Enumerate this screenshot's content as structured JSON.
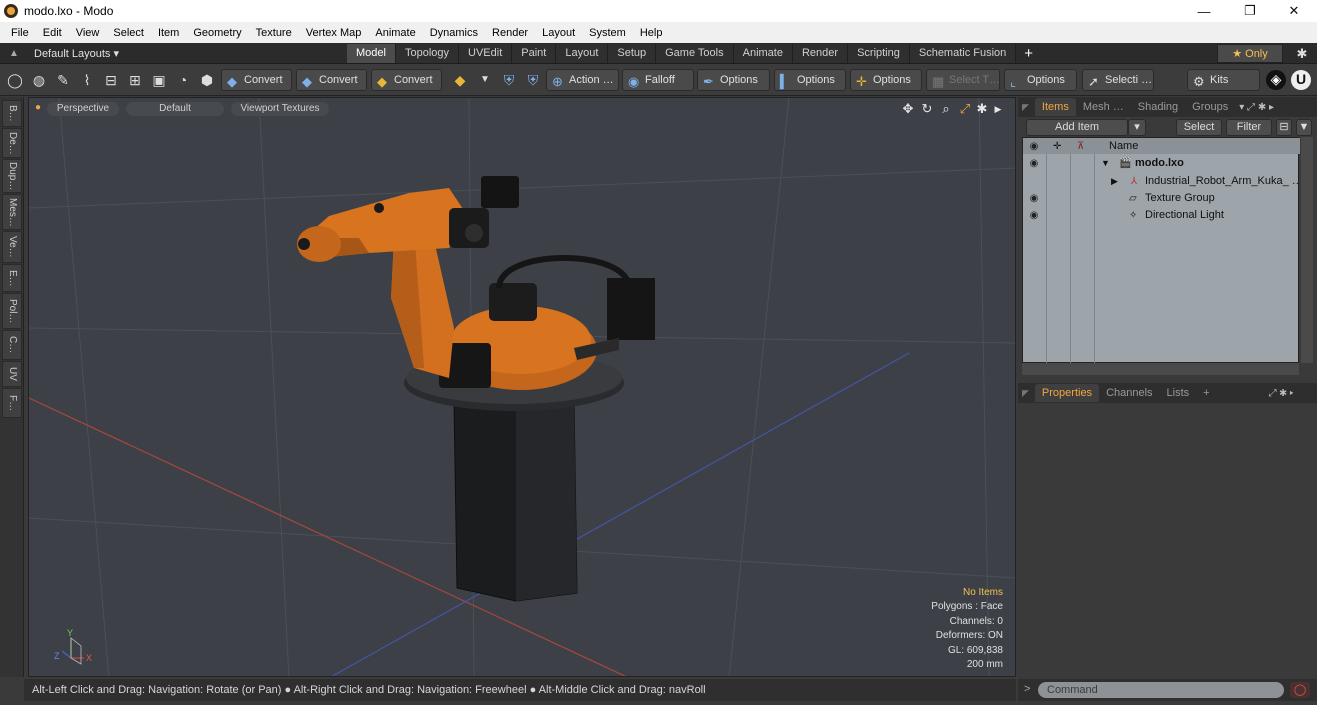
{
  "window": {
    "title": "modo.lxo - Modo",
    "minimize_glyph": "—",
    "restore_glyph": "❐",
    "close_glyph": "✕"
  },
  "menu": [
    "File",
    "Edit",
    "View",
    "Select",
    "Item",
    "Geometry",
    "Texture",
    "Vertex Map",
    "Animate",
    "Dynamics",
    "Render",
    "Layout",
    "System",
    "Help"
  ],
  "layoutbar": {
    "layouts_label": "Default Layouts ▾",
    "tabs": [
      "Model",
      "Topology",
      "UVEdit",
      "Paint",
      "Layout",
      "Setup",
      "Game Tools",
      "Animate",
      "Render",
      "Scripting",
      "Schematic Fusion"
    ],
    "active_tab": "Model",
    "add_glyph": "+",
    "only_label": "★  Only",
    "gear_glyph": "✱"
  },
  "toolbar": {
    "convert_1": "Convert",
    "convert_2": "Convert",
    "convert_3": "Convert",
    "action": "Action  …",
    "falloff": "Falloff",
    "options_1": "Options",
    "options_2": "Options",
    "options_3": "Options",
    "select_t": "Select T…",
    "options_4": "Options",
    "selecti": "Selecti …",
    "kits": "Kits"
  },
  "left_tabs": [
    "B…",
    "De…",
    "Dup…",
    "Mes…",
    "Ve…",
    "E…",
    "Pol…",
    "C…",
    "UV",
    "F…"
  ],
  "viewport": {
    "view_mode": "Perspective",
    "shading": "Default",
    "textures": "Viewport Textures",
    "stats": {
      "selection": "No Items",
      "polygons": "Polygons : Face",
      "channels": "Channels: 0",
      "deformers": "Deformers: ON",
      "gl": "GL: 609,838",
      "scale": "200 mm"
    },
    "axis_x": "X",
    "axis_y": "Y",
    "axis_z": "Z"
  },
  "items_panel": {
    "tabs": [
      "Items",
      "Mesh …",
      "Shading",
      "Groups"
    ],
    "active_tab": "Items",
    "add_item": "Add Item",
    "select": "Select",
    "filter": "Filter",
    "name_header": "Name",
    "rows": [
      {
        "name": "modo.lxo",
        "bold": true
      },
      {
        "name": "Industrial_Robot_Arm_Kuka_ …",
        "bold": false
      },
      {
        "name": "Texture Group",
        "bold": false
      },
      {
        "name": "Directional Light",
        "bold": false
      }
    ]
  },
  "properties_panel": {
    "tabs": [
      "Properties",
      "Channels",
      "Lists"
    ],
    "active_tab": "Properties",
    "add_glyph": "+"
  },
  "statusbar": {
    "hint": "Alt-Left Click and Drag: Navigation: Rotate (or Pan) ● Alt-Right Click and Drag: Navigation: Freewheel ● Alt-Middle Click and Drag: navRoll"
  },
  "command": {
    "placeholder": "Command"
  },
  "colors": {
    "accent_orange": "#f3a640",
    "robot_orange": "#d8731f",
    "viewport_bg": "#3d4147",
    "x_axis": "#b0453a",
    "z_axis": "#4656a8"
  }
}
